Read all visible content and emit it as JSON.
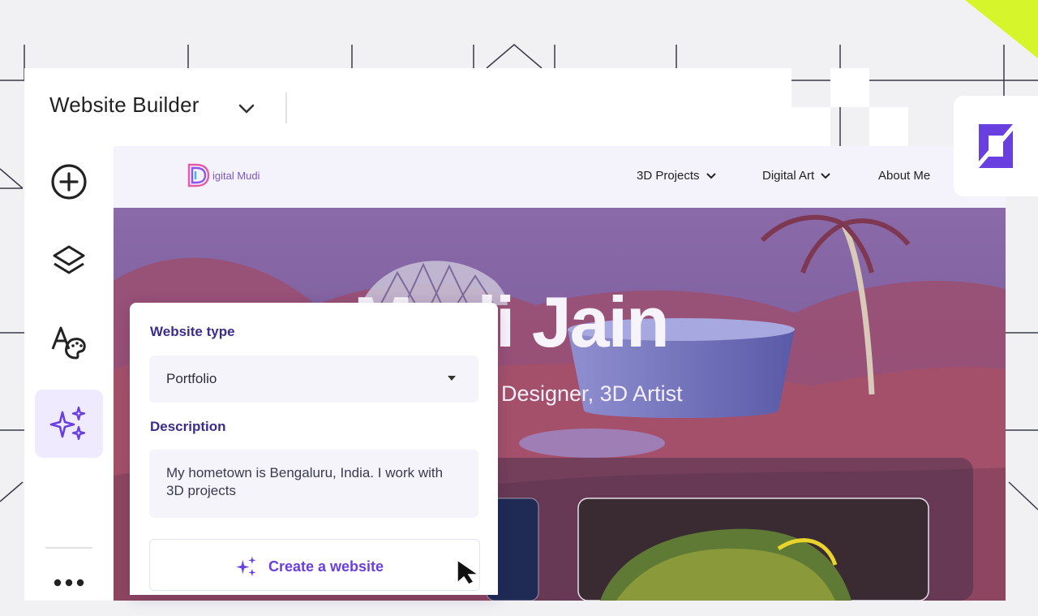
{
  "builder": {
    "title": "Website Builder",
    "sidebar": [
      {
        "name": "add",
        "icon": "plus-circle-icon"
      },
      {
        "name": "layers",
        "icon": "layers-icon"
      },
      {
        "name": "theme",
        "icon": "typography-palette-icon"
      },
      {
        "name": "ai",
        "icon": "sparkles-icon",
        "active": true
      },
      {
        "name": "more",
        "icon": "more-dots-icon"
      }
    ]
  },
  "site": {
    "logo_text": "igital Mudi",
    "nav": [
      {
        "label": "3D Projects",
        "has_dropdown": true
      },
      {
        "label": "Digital Art",
        "has_dropdown": true
      },
      {
        "label": "About Me",
        "has_dropdown": false
      }
    ],
    "hero": {
      "name": "Mudi Jain",
      "role": "Designer, 3D Artist"
    }
  },
  "panel": {
    "website_type_label": "Website type",
    "website_type_value": "Portfolio",
    "description_label": "Description",
    "description_value": "My hometown is Bengaluru, India. I work with 3D projects",
    "cta_label": "Create a website"
  },
  "colors": {
    "accent": "#6a3fe0",
    "label": "#3d2d8a",
    "lime": "#d7f52b",
    "active_bg": "#efeafd"
  }
}
